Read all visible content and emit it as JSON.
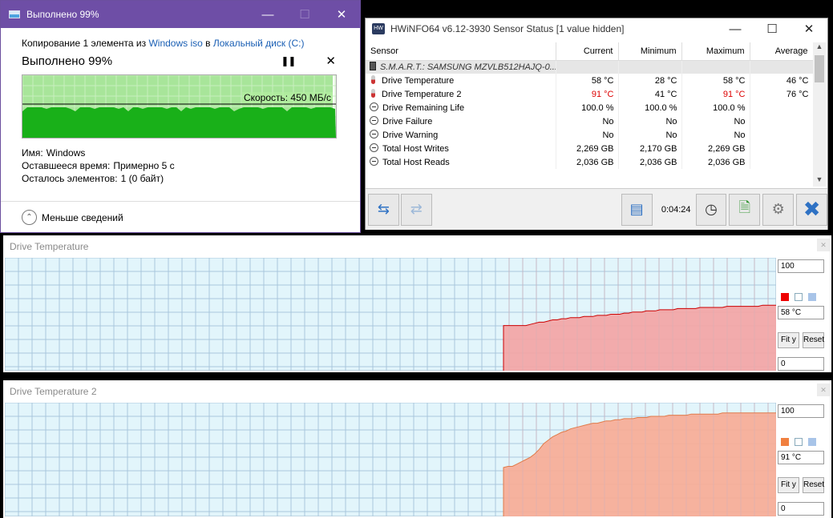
{
  "copy_dialog": {
    "title": "Выполнено 99%",
    "source_prefix": "Копирование 1 элемента из ",
    "source_name": "Windows iso",
    "source_mid": " в ",
    "dest_name": "Локальный диск (C:)",
    "progress_title": "Выполнено 99%",
    "speed_label": "Скорость: 450 МБ/с",
    "progress_fraction": 0.99,
    "details": {
      "name_label": "Имя:",
      "name_value": "Windows",
      "time_label": "Оставшееся время:",
      "time_value": "Примерно 5 с",
      "items_label": "Осталось элементов:",
      "items_value": "1 (0 байт)"
    },
    "less_details": "Меньше сведений",
    "colors": {
      "titlebar": "#6e4ea6",
      "graph_fill": "#19b019",
      "graph_light": "#a8e59a"
    }
  },
  "hwinfo": {
    "title": "HWiNFO64 v6.12-3930 Sensor Status [1 value hidden]",
    "columns": [
      "Sensor",
      "Current",
      "Minimum",
      "Maximum",
      "Average"
    ],
    "group": "S.M.A.R.T.: SAMSUNG MZVLB512HAJQ-0...",
    "rows": [
      {
        "icon": "therm",
        "name": "Drive Temperature",
        "current": "58 °C",
        "minimum": "28 °C",
        "maximum": "58 °C",
        "average": "46 °C",
        "alert": false
      },
      {
        "icon": "therm",
        "name": "Drive Temperature 2",
        "current": "91 °C",
        "minimum": "41 °C",
        "maximum": "91 °C",
        "average": "76 °C",
        "alert": true
      },
      {
        "icon": "gauge",
        "name": "Drive Remaining Life",
        "current": "100.0 %",
        "minimum": "100.0 %",
        "maximum": "100.0 %",
        "average": "",
        "alert": false
      },
      {
        "icon": "gauge",
        "name": "Drive Failure",
        "current": "No",
        "minimum": "No",
        "maximum": "No",
        "average": "",
        "alert": false
      },
      {
        "icon": "gauge",
        "name": "Drive Warning",
        "current": "No",
        "minimum": "No",
        "maximum": "No",
        "average": "",
        "alert": false
      },
      {
        "icon": "gauge",
        "name": "Total Host Writes",
        "current": "2,269 GB",
        "minimum": "2,170 GB",
        "maximum": "2,269 GB",
        "average": "",
        "alert": false
      },
      {
        "icon": "gauge",
        "name": "Total Host Reads",
        "current": "2,036 GB",
        "minimum": "2,036 GB",
        "maximum": "2,036 GB",
        "average": "",
        "alert": false
      }
    ],
    "timer": "0:04:24",
    "colors": {
      "alert": "#dd0000",
      "group_bg": "#e6e6e6"
    }
  },
  "graphs": [
    {
      "title": "Drive Temperature",
      "max": "100",
      "min": "0",
      "current": "58 °C",
      "fit_label": "Fit y",
      "reset_label": "Reset",
      "line_color": "#cc0000",
      "fill_color": "#f4a3a3",
      "swatch_color": "#ee0000",
      "ymax": 100,
      "samples": [
        40,
        40,
        40,
        40,
        40,
        40,
        41,
        42,
        43,
        43,
        44,
        45,
        45,
        46,
        46,
        47,
        47,
        47,
        48,
        48,
        48,
        49,
        49,
        49,
        50,
        50,
        50,
        51,
        51,
        52,
        52,
        52,
        53,
        53,
        53,
        54,
        54,
        54,
        54,
        55,
        55,
        55,
        55,
        55,
        56,
        56,
        56,
        56,
        56,
        56,
        57,
        57,
        57,
        57,
        57,
        57,
        57,
        57,
        58,
        58,
        58,
        58
      ]
    },
    {
      "title": "Drive Temperature 2",
      "max": "100",
      "min": "0",
      "current": "91 °C",
      "fit_label": "Fit y",
      "reset_label": "Reset",
      "line_color": "#e07b4a",
      "fill_color": "#f8ab93",
      "swatch_color": "#f08040",
      "ymax": 100,
      "samples": [
        43,
        44,
        44,
        46,
        48,
        50,
        52,
        55,
        59,
        64,
        67,
        70,
        72,
        74,
        75,
        77,
        78,
        79,
        80,
        81,
        82,
        82,
        83,
        84,
        84,
        85,
        85,
        86,
        86,
        86,
        87,
        87,
        87,
        88,
        88,
        88,
        88,
        89,
        89,
        89,
        89,
        89,
        90,
        90,
        90,
        90,
        90,
        90,
        90,
        91,
        91,
        91,
        91,
        91,
        91,
        91,
        91,
        91,
        91,
        91,
        91,
        91
      ]
    }
  ]
}
